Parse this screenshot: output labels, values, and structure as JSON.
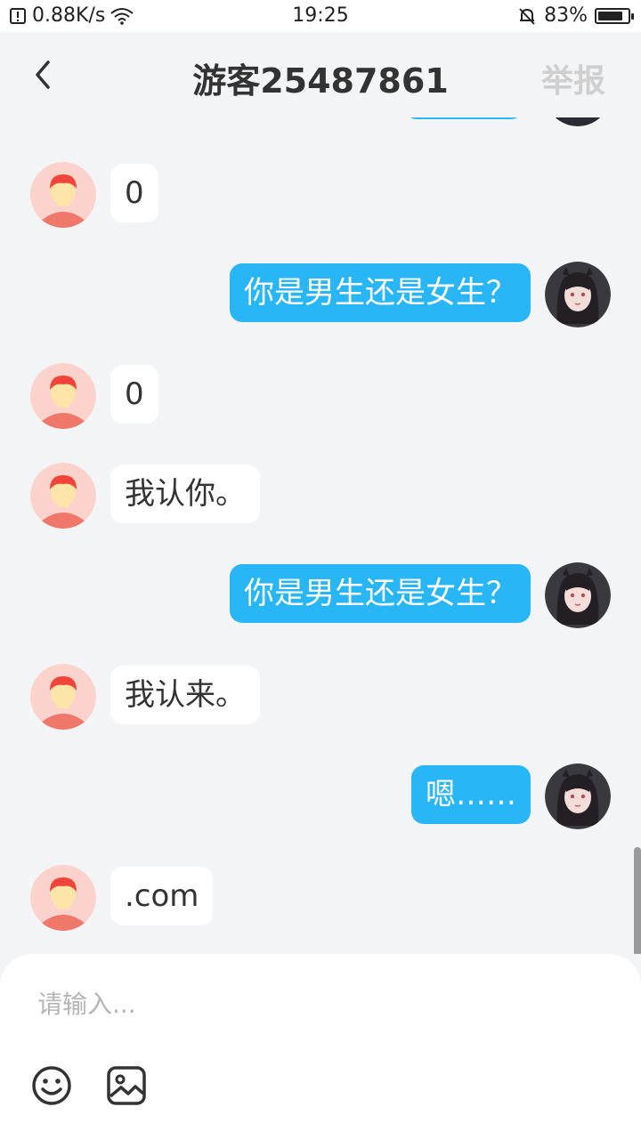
{
  "status_bar": {
    "speed": "0.88K/s",
    "time": "19:25",
    "battery_text": "83%",
    "battery_level": 0.83,
    "icons": [
      "storage-icon",
      "wifi-icon",
      "mute-bell-icon",
      "battery-icon"
    ]
  },
  "nav": {
    "back_icon": "chevron-left-icon",
    "title": "游客25487861",
    "report": "举报"
  },
  "messages": [
    {
      "side": "in",
      "text": "0"
    },
    {
      "side": "out",
      "text": "你是男生还是女生？"
    },
    {
      "side": "in",
      "text": "0"
    },
    {
      "side": "in",
      "text": "我认你。"
    },
    {
      "side": "out",
      "text": "你是男生还是女生？"
    },
    {
      "side": "in",
      "text": "我认来。"
    },
    {
      "side": "out",
      "text": "嗯……"
    },
    {
      "side": "in",
      "text": ".com"
    }
  ],
  "composer": {
    "placeholder": "请输入...",
    "emoji_icon": "smiley-icon",
    "image_icon": "image-icon"
  },
  "colors": {
    "outgoing_bubble": "#29b6f6",
    "incoming_bubble": "#ffffff",
    "background": "#f3f4f6",
    "report_text": "#cfcfcf"
  }
}
